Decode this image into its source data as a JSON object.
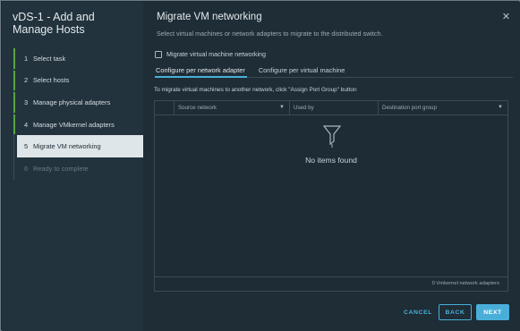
{
  "wizard": {
    "title": "vDS-1 - Add and Manage Hosts",
    "steps": [
      {
        "number": "1",
        "label": "Select task"
      },
      {
        "number": "2",
        "label": "Select hosts"
      },
      {
        "number": "3",
        "label": "Manage physical adapters"
      },
      {
        "number": "4",
        "label": "Manage VMkernel adapters"
      },
      {
        "number": "5",
        "label": "Migrate VM networking"
      },
      {
        "number": "6",
        "label": "Ready to complete"
      }
    ]
  },
  "main": {
    "title": "Migrate VM networking",
    "subtitle": "Select virtual machines or network adapters to migrate to the distributed switch.",
    "checkbox_label": "Migrate virtual machine networking",
    "tabs": [
      {
        "label": "Configure per network adapter"
      },
      {
        "label": "Configure per virtual machine"
      }
    ],
    "hint": "To migrate virtual machines to another network, click \"Assign Port Group\" button",
    "grid": {
      "columns": [
        "Source network",
        "Used by",
        "Destination port group"
      ],
      "empty_text": "No items found",
      "footer": "0 Vmkernel network adapters"
    }
  },
  "buttons": {
    "cancel": "CANCEL",
    "back": "BACK",
    "next": "NEXT"
  },
  "icons": {
    "close": "close-icon",
    "filter": "filter-icon",
    "empty": "filter-funnel-icon"
  },
  "colors": {
    "accent": "#49afd9",
    "completed_step": "#5aa53f",
    "background": "#1e2d36"
  }
}
